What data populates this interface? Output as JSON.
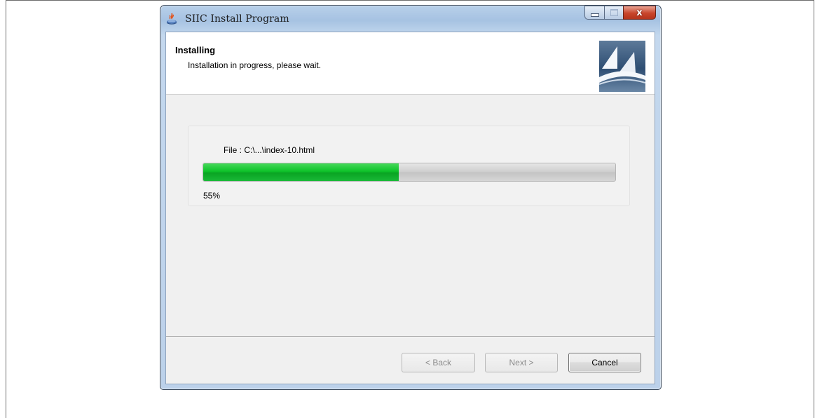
{
  "window": {
    "title": "SIIC Install Program",
    "app_icon": "java-installer-icon",
    "caption_buttons": {
      "minimize": "minimize-icon",
      "maximize": "maximize-icon",
      "close": "close-icon",
      "close_glyph": "x"
    }
  },
  "header": {
    "title": "Installing",
    "subtitle": "Installation in progress, please wait.",
    "logo": "sail-logo-icon"
  },
  "progress": {
    "file_label": "File :  C:\\...\\index-10.html",
    "percent": 0.475,
    "percent_text": "55%"
  },
  "buttons": {
    "back": "< Back",
    "next": "Next >",
    "cancel": "Cancel"
  },
  "colors": {
    "progress_fill": "#0fc22a",
    "title_bar": "#b9d1ea",
    "close_button": "#c8452b"
  }
}
